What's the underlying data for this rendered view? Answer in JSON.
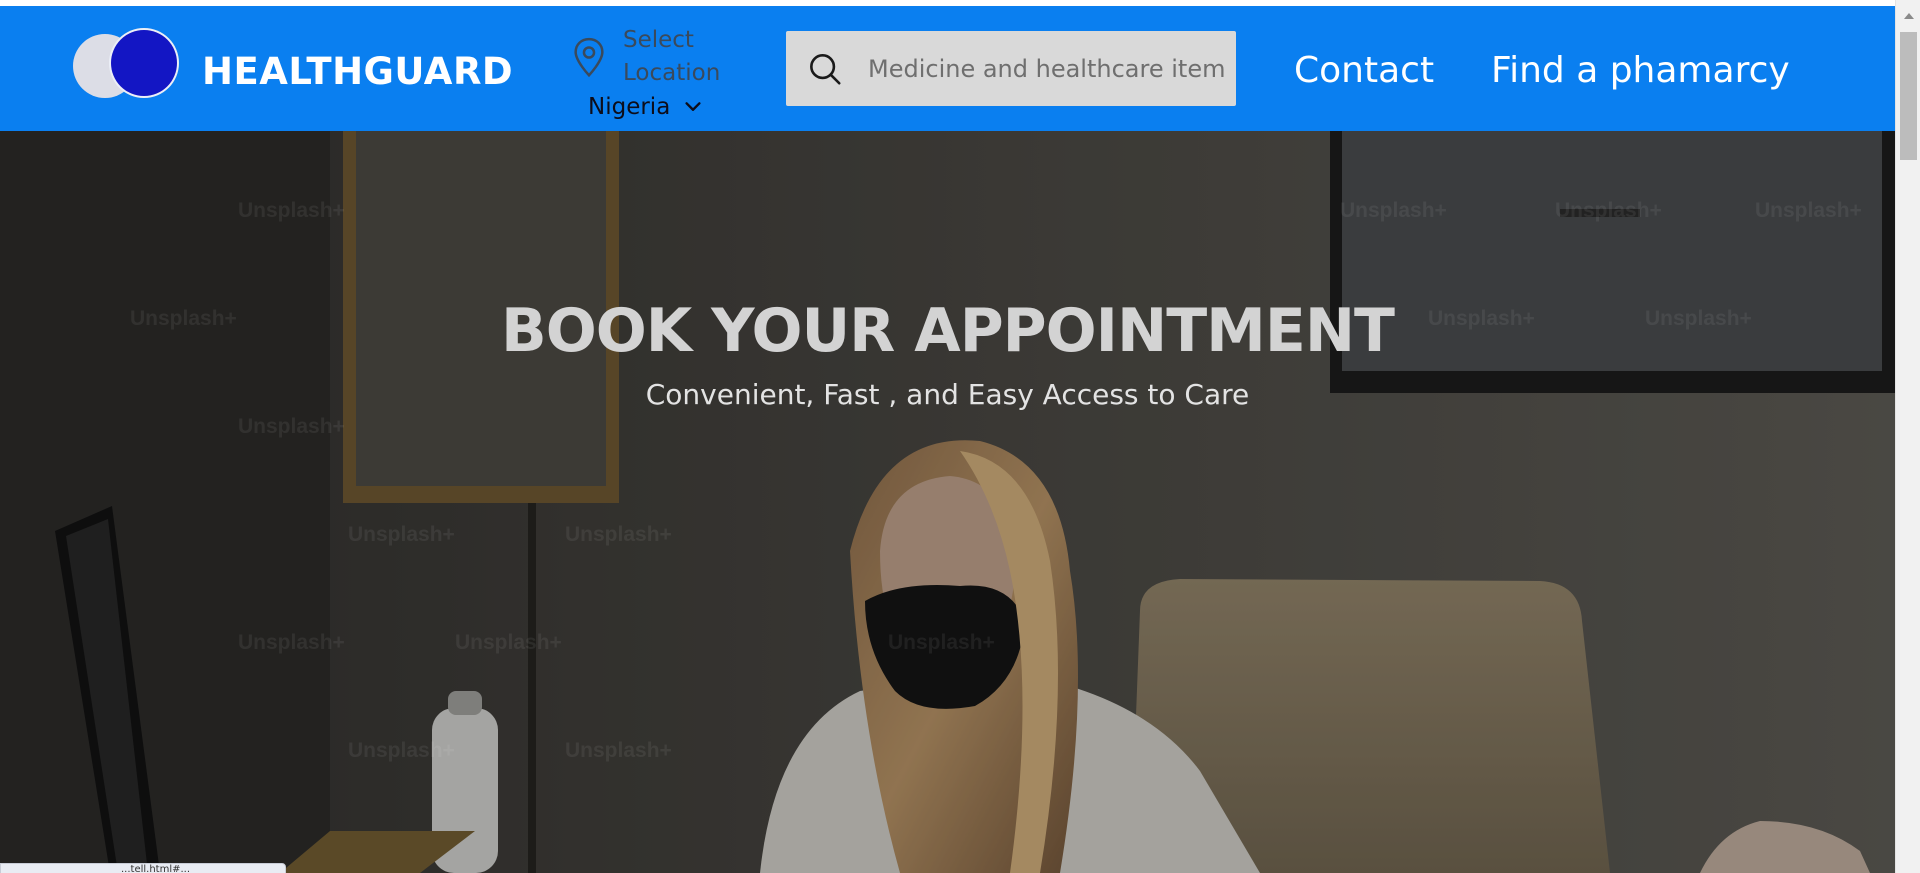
{
  "header": {
    "brand": "HEALTHGUARD",
    "location_label": "Select Location",
    "location_value": "Nigeria",
    "search_placeholder": "Medicine and healthcare item",
    "nav": {
      "contact": "Contact",
      "find_pharmacy": "Find a phamarcy"
    }
  },
  "hero": {
    "title": "BOOK YOUR APPOINTMENT",
    "subtitle": "Convenient, Fast , and Easy Access to Care",
    "watermark": "Unsplash+"
  },
  "status_bar": {
    "text": "...tell.html#..."
  },
  "colors": {
    "navbar": "#0a7ff0",
    "logo_dark": "#1316c4",
    "logo_light": "#dcdde6",
    "search_bg": "#d9d9d9"
  },
  "icons": [
    "location-pin-icon",
    "chevron-down-icon",
    "search-icon"
  ]
}
